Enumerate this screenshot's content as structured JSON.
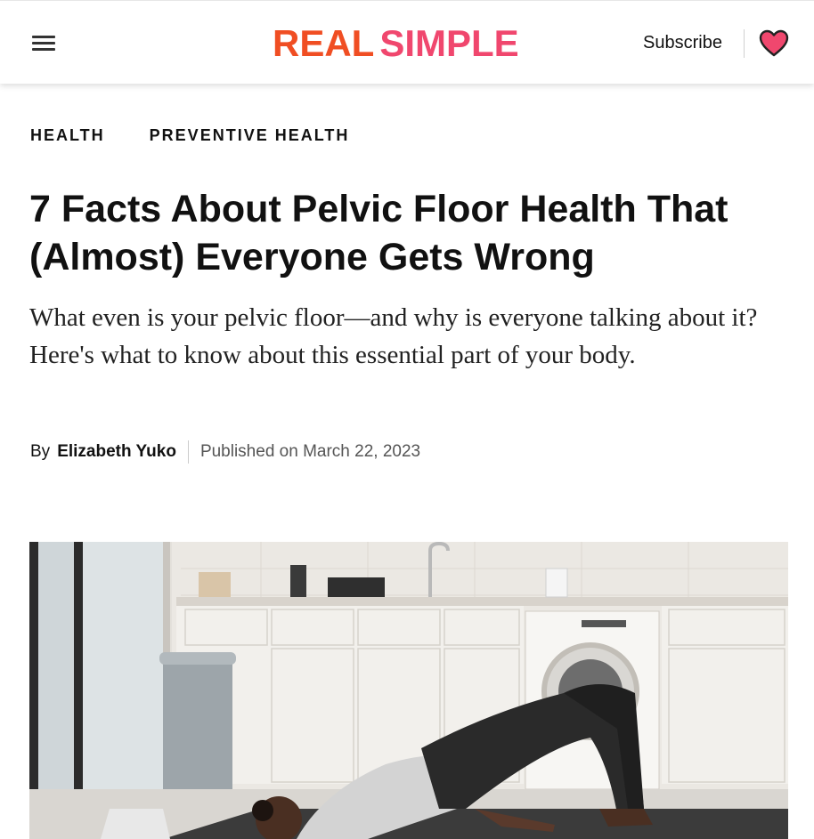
{
  "header": {
    "menu_icon": "hamburger-menu-icon",
    "logo": {
      "part1": "REAL",
      "part2": "SIMPLE"
    },
    "subscribe_label": "Subscribe",
    "heart_icon": "heart-icon",
    "colors": {
      "logo_real": "#f04e23",
      "logo_simple": "#f0476e",
      "heart": "#f0476e"
    }
  },
  "breadcrumb": [
    "HEALTH",
    "PREVENTIVE HEALTH"
  ],
  "article": {
    "title": "7 Facts About Pelvic Floor Health That (Almost) Everyone Gets Wrong",
    "dek": "What even is your pelvic floor—and why is everyone talking about it? Here's what to know about this essential part of your body.",
    "byline": {
      "by": "By",
      "author": "Elizabeth Yuko",
      "published": "Published on March 22, 2023"
    },
    "hero_image": "woman-doing-glute-bridge-in-kitchen-photo"
  }
}
